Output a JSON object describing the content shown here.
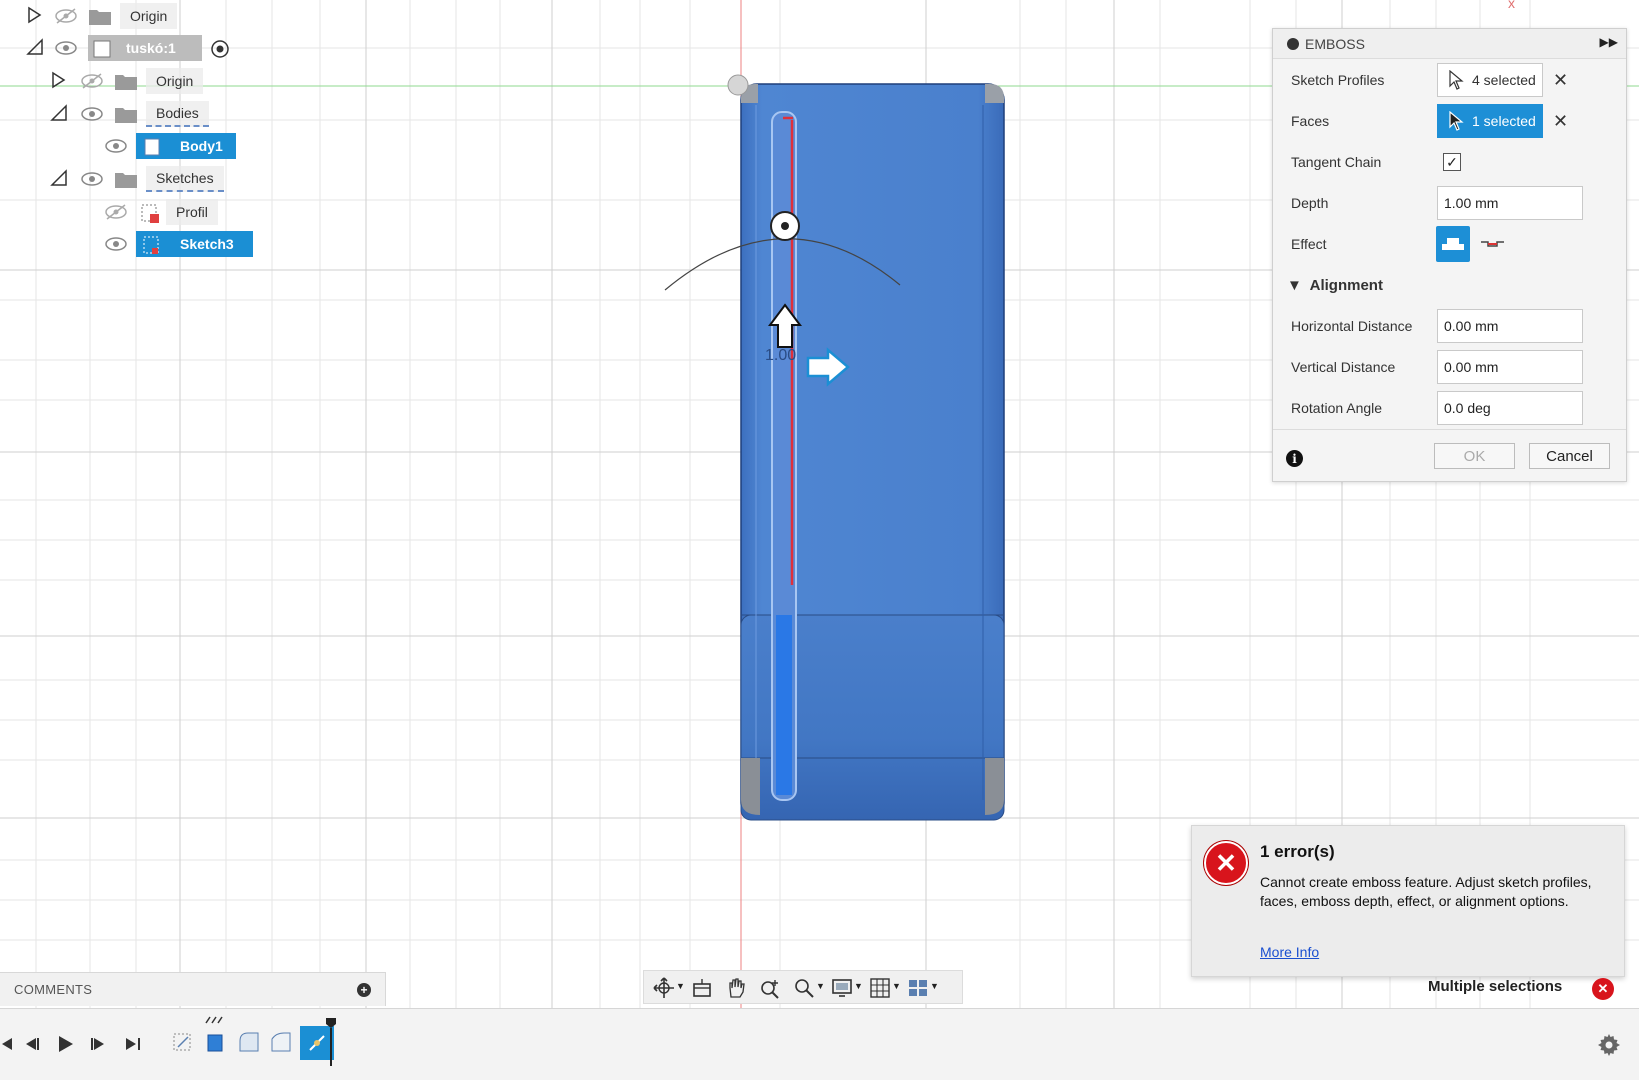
{
  "browser_tree": [
    {
      "label": "Origin",
      "icon": "eye-hidden-icon",
      "kind": "folder",
      "collapsed": true
    },
    {
      "label": "tuskó:1",
      "icon": "eye-icon",
      "kind": "component",
      "expanded": true
    },
    {
      "label": "Origin",
      "icon": "eye-hidden-icon",
      "kind": "folder",
      "collapsed": true
    },
    {
      "label": "Bodies",
      "icon": "eye-icon",
      "kind": "folder",
      "expanded": true
    },
    {
      "label": "Body1",
      "icon": "eye-icon",
      "kind": "body",
      "selected": true
    },
    {
      "label": "Sketches",
      "icon": "eye-icon",
      "kind": "folder",
      "expanded": true
    },
    {
      "label": "Profil",
      "icon": "eye-hidden-icon",
      "kind": "sketch"
    },
    {
      "label": "Sketch3",
      "icon": "eye-icon",
      "kind": "sketch",
      "selected": true
    }
  ],
  "emboss": {
    "title": "EMBOSS",
    "sketch_profiles_label": "Sketch Profiles",
    "sketch_profiles_value": "4 selected",
    "faces_label": "Faces",
    "faces_value": "1 selected",
    "tangent_chain_label": "Tangent Chain",
    "tangent_chain_checked": true,
    "depth_label": "Depth",
    "depth_value": "1.00 mm",
    "effect_label": "Effect",
    "alignment_label": "Alignment",
    "horizontal_distance_label": "Horizontal Distance",
    "horizontal_distance_value": "0.00 mm",
    "vertical_distance_label": "Vertical Distance",
    "vertical_distance_value": "0.00 mm",
    "rotation_angle_label": "Rotation Angle",
    "rotation_angle_value": "0.0 deg",
    "ok_label": "OK",
    "cancel_label": "Cancel"
  },
  "error": {
    "title": "1 error(s)",
    "message": "Cannot create emboss feature. Adjust sketch profiles, faces, emboss depth, effect, or alignment options.",
    "link": "More Info"
  },
  "status": {
    "multiple_selections": "Multiple selections"
  },
  "comments": {
    "label": "COMMENTS"
  },
  "viewport": {
    "dimension_text": "1.00",
    "accent": "#1b8fd4",
    "body_color": "#4a7fcb",
    "error_color": "#d8141c"
  }
}
